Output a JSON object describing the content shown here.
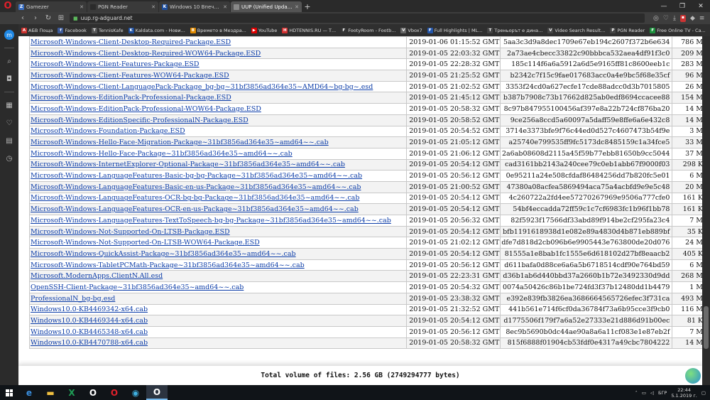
{
  "browser": {
    "tabs": [
      {
        "label": "Gamezer",
        "icon_color": "#3a6fc4",
        "letter": "Z",
        "active": false
      },
      {
        "label": "PGN Reader",
        "icon_color": "#2b2b2b",
        "letter": "",
        "active": false
      },
      {
        "label": "Windows 10 Впечатлени",
        "icon_color": "#1d4e9e",
        "letter": "K",
        "active": false
      },
      {
        "label": "UUP (Unified Update Platf",
        "icon_color": "#888888",
        "letter": "",
        "active": true
      }
    ],
    "url": "uup.rg-adguard.net",
    "logo_letter": "O",
    "bookmarks": [
      {
        "label": "АБВ Поща",
        "color": "#c9302c",
        "letter": "A"
      },
      {
        "label": "Facebook",
        "color": "#3b5998",
        "letter": "f"
      },
      {
        "label": "TennisKafe",
        "color": "#555555",
        "letter": "T"
      },
      {
        "label": "Kaldata.com - Нови...",
        "color": "#1d4e9e",
        "letter": "K"
      },
      {
        "label": "Времето в Мездра...",
        "color": "#e08a00",
        "letter": "B"
      },
      {
        "label": "YouTube",
        "color": "#e00000",
        "letter": "▶"
      },
      {
        "label": "HDTENNIS.RU — Т...",
        "color": "#d03030",
        "letter": "H"
      },
      {
        "label": "FootyRoom - Footb...",
        "color": "#333333",
        "letter": "F"
      },
      {
        "label": "Vbox7",
        "color": "#666666",
        "letter": "V"
      },
      {
        "label": "Full Highlights | ML...",
        "color": "#2255aa",
        "letter": "F"
      },
      {
        "label": "Треньорът е дина...",
        "color": "#444444",
        "letter": "Т"
      },
      {
        "label": "Video Search Result...",
        "color": "#444444",
        "letter": "V"
      },
      {
        "label": "PGN Reader",
        "color": "#444444",
        "letter": "P"
      },
      {
        "label": "Free Online TV - Ca...",
        "color": "#1b8f3b",
        "letter": "F"
      },
      {
        "label": "Gamezer",
        "color": "#3a6fc4",
        "letter": "Z"
      }
    ],
    "messenger_letter": "m"
  },
  "files": [
    {
      "name": "Microsoft-Windows-Client-Desktop-Required-Package.ESD",
      "date": "2019-01-06 01:15:52 GMT",
      "hash": "5aa3c3d9a8dec1709e67eb194c2607f372b6e634",
      "size": "786 MB"
    },
    {
      "name": "Microsoft-Windows-Client-Desktop-Required-WOW64-Package.ESD",
      "date": "2019-01-05 22:03:32 GMT",
      "hash": "2a73ae4cbecc33822c90bbbca532aea4df91f3c0",
      "size": "209 MB"
    },
    {
      "name": "Microsoft-Windows-Client-Features-Package.ESD",
      "date": "2019-01-05 22:28:32 GMT",
      "hash": "185c114f6a6a5912a6d5e9165ff81c8600eeb1c",
      "size": "283 MB"
    },
    {
      "name": "Microsoft-Windows-Client-Features-WOW64-Package.ESD",
      "date": "2019-01-05 21:25:52 GMT",
      "hash": "b2342c7f15c9fae017683acc0a4e9bc5f68e35cf",
      "size": "96 MB"
    },
    {
      "name": "Microsoft-Windows-Client-LanguagePack-Package_bg-bg~31bf3856ad364e35~AMD64~bg-bg~.esd",
      "date": "2019-01-05 21:02:52 GMT",
      "hash": "3353f24cd0a627ecfe17cde88adcc0d3b7015805",
      "size": "26 MB"
    },
    {
      "name": "Microsoft-Windows-EditionPack-Professional-Package.ESD",
      "date": "2019-01-05 21:45:12 GMT",
      "hash": "b387b7908c73b17662d825ab0edf8694ccacee88",
      "size": "154 MB"
    },
    {
      "name": "Microsoft-Windows-EditionPack-Professional-WOW64-Package.ESD",
      "date": "2019-01-05 20:58:32 GMT",
      "hash": "8c97b847955100456af397e8a22b724cf876ba20",
      "size": "14 MB"
    },
    {
      "name": "Microsoft-Windows-EditionSpecific-ProfessionalN-Package.ESD",
      "date": "2019-01-05 20:58:52 GMT",
      "hash": "9ce256a8ccd5a60097a5daff59e8ffe6a6e432c8",
      "size": "14 MB"
    },
    {
      "name": "Microsoft-Windows-Foundation-Package.ESD",
      "date": "2019-01-05 20:54:52 GMT",
      "hash": "3714e3373bfe9f76c44ed0d527c4607473b54f9e",
      "size": "3 MB"
    },
    {
      "name": "Microsoft-Windows-Hello-Face-Migration-Package~31bf3856ad364e35~amd64~~.cab",
      "date": "2019-01-05 21:05:12 GMT",
      "hash": "a25740e799535ff9fc5173dc8485159c1a34fce5",
      "size": "33 MB"
    },
    {
      "name": "Microsoft-Windows-Hello-Face-Package~31bf3856ad364e35~amd64~~.cab",
      "date": "2019-01-05 21:06:12 GMT",
      "hash": "2a6ab08608d2115a45f59b77ebb81650b9cc5044",
      "size": "37 MB"
    },
    {
      "name": "Microsoft-Windows-InternetExplorer-Optional-Package~31bf3856ad364e35~amd64~~.cab",
      "date": "2019-01-05 20:54:12 GMT",
      "hash": "cad3161bb2143a240cee79c0eb1abb67f9000f03",
      "size": "298 KB"
    },
    {
      "name": "Microsoft-Windows-LanguageFeatures-Basic-bg-bg-Package~31bf3856ad364e35~amd64~~.cab",
      "date": "2019-01-05 20:56:12 GMT",
      "hash": "0e95211a24e508cfdaf86484256dd7b820fc5e01",
      "size": "6 MB"
    },
    {
      "name": "Microsoft-Windows-LanguageFeatures-Basic-en-us-Package~31bf3856ad364e35~amd64~~.cab",
      "date": "2019-01-05 21:00:52 GMT",
      "hash": "47380a08acfea5869494aca75a4acbfd9e9e5c48",
      "size": "20 MB"
    },
    {
      "name": "Microsoft-Windows-LanguageFeatures-OCR-bg-bg-Package~31bf3856ad364e35~amd64~~.cab",
      "date": "2019-01-05 20:54:12 GMT",
      "hash": "4c260722a2fd4ee57270267969e9506a777cfe0",
      "size": "161 KB"
    },
    {
      "name": "Microsoft-Windows-LanguageFeatures-OCR-en-us-Package~31bf3856ad364e35~amd64~~.cab",
      "date": "2019-01-05 20:54:12 GMT",
      "hash": "54bf4eccadda72ff59c1c7cf6983fc1b96f1bb78",
      "size": "161 KB"
    },
    {
      "name": "Microsoft-Windows-LanguageFeatures-TextToSpeech-bg-bg-Package~31bf3856ad364e35~amd64~~.cab",
      "date": "2019-01-05 20:56:32 GMT",
      "hash": "82f5923f17566df33abd89f914be2cf295fa23c4",
      "size": "7 MB"
    },
    {
      "name": "Microsoft-Windows-Not-Supported-On-LTSB-Package.ESD",
      "date": "2019-01-05 20:54:12 GMT",
      "hash": "bfb1191618938d1e082e89a4830d4b871eb889bf",
      "size": "35 KB"
    },
    {
      "name": "Microsoft-Windows-Not-Supported-On-LTSB-WOW64-Package.ESD",
      "date": "2019-01-05 21:02:12 GMT",
      "hash": "dfe7d818d2cb096b6e9905443e763800de20d076",
      "size": "24 MB"
    },
    {
      "name": "Microsoft-Windows-QuickAssist-Package~31bf3856ad364e35~amd64~~.cab",
      "date": "2019-01-05 20:54:12 GMT",
      "hash": "81555a1e8bab1fc1555e6d618102d27bf8eaacb2",
      "size": "405 KB"
    },
    {
      "name": "Microsoft-Windows-TabletPCMath-Package~31bf3856ad364e35~amd64~~.cab",
      "date": "2019-01-05 20:56:12 GMT",
      "hash": "d611bafa0d88ce6a6a5b6718514cdf90e764bd59",
      "size": "6 MB"
    },
    {
      "name": "Microsoft.ModernApps.ClientN.All.esd",
      "date": "2019-01-05 22:23:31 GMT",
      "hash": "d36b1ab6d440bbd37a2660b1b72e3492330d9dd",
      "size": "268 MB"
    },
    {
      "name": "OpenSSH-Client-Package~31bf3856ad364e35~amd64~~.cab",
      "date": "2019-01-05 20:54:32 GMT",
      "hash": "0074a50426c86b1be724fd3f37b12480dd1b4479",
      "size": "1 MB"
    },
    {
      "name": "ProfessionalN_bg-bg.esd",
      "date": "2019-01-05 23:38:32 GMT",
      "hash": "e392e839fb3826ea3686664565726efec3f731ca",
      "size": "493 MB"
    },
    {
      "name": "Windows10.0-KB4469342-x64.cab",
      "date": "2019-01-05 21:32:52 GMT",
      "hash": "441b561e714f6cf0da36784f73a6b95cce3f9cb0",
      "size": "116 MB"
    },
    {
      "name": "Windows10.0-KB4469344-x64.cab",
      "date": "2019-01-05 20:54:12 GMT",
      "hash": "d1775506f179f7a6a52e27333e21d886d91b00ec",
      "size": "81 KB"
    },
    {
      "name": "Windows10.0-KB4465348-x64.cab",
      "date": "2019-01-05 20:56:12 GMT",
      "hash": "8ec9b5690b0dc44ae90a8a6a11cf083e1e87eb2f",
      "size": "7 MB"
    },
    {
      "name": "Windows10.0-KB4470788-x64.cab",
      "date": "2019-01-05 20:58:32 GMT",
      "hash": "815f6888f01904cb53fdf0e4317a49cbc7804222",
      "size": "14 MB"
    }
  ],
  "summary": {
    "label": "Total volume of files:",
    "value": "2.56 GB (2749294777 bytes)"
  },
  "taskbar": {
    "apps": [
      {
        "name": "ie-icon",
        "glyph": "e",
        "color": "#3a8fe0",
        "active": false
      },
      {
        "name": "file-explorer-icon",
        "glyph": "▬",
        "color": "#f0c040",
        "active": false
      },
      {
        "name": "excel-icon",
        "glyph": "X",
        "color": "#1f9d55",
        "active": false
      },
      {
        "name": "opera-icon",
        "glyph": "O",
        "color": "#ffffff",
        "active": false
      },
      {
        "name": "opera-red-icon",
        "glyph": "O",
        "color": "#e0202b",
        "active": false
      },
      {
        "name": "chrome-icon",
        "glyph": "◉",
        "color": "#3fb0e0",
        "active": false
      },
      {
        "name": "opera-active-icon",
        "glyph": "O",
        "color": "#ffffff",
        "active": true
      }
    ],
    "language": "БГР",
    "time": "22:44",
    "date": "5.1.2019 г."
  }
}
